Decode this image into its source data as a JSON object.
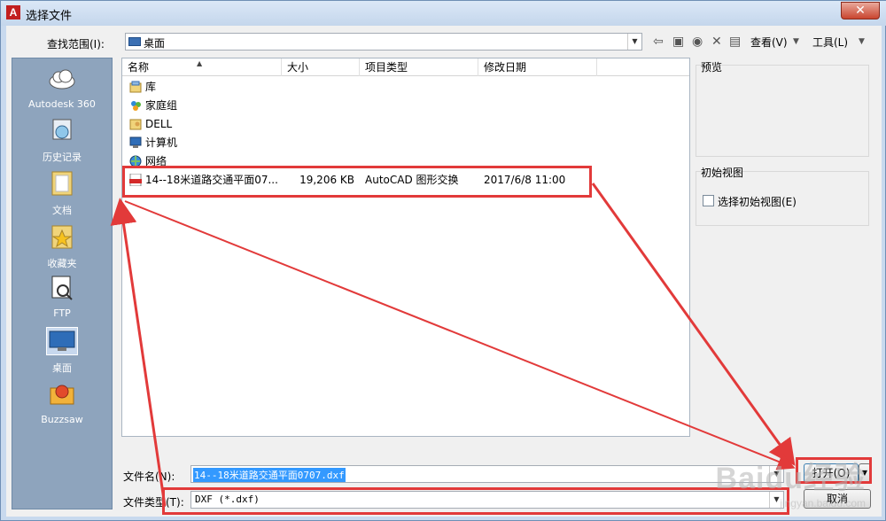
{
  "window": {
    "app_icon": "A",
    "title": "选择文件",
    "close_label": "✕"
  },
  "toolbar": {
    "lookin_label": "查找范围(I):",
    "lookin_value": "桌面",
    "view_label": "查看(V)",
    "tools_label": "工具(L)"
  },
  "places": [
    {
      "label": "Autodesk 360",
      "icon": "cloud-icon"
    },
    {
      "label": "历史记录",
      "icon": "history-icon"
    },
    {
      "label": "文档",
      "icon": "documents-icon"
    },
    {
      "label": "收藏夹",
      "icon": "favorites-icon"
    },
    {
      "label": "FTP",
      "icon": "ftp-icon"
    },
    {
      "label": "桌面",
      "icon": "desktop-icon"
    },
    {
      "label": "Buzzsaw",
      "icon": "buzzsaw-icon"
    }
  ],
  "columns": [
    "名称",
    "大小",
    "项目类型",
    "修改日期"
  ],
  "files": [
    {
      "name": "库",
      "size": "",
      "type": "",
      "date": "",
      "icon": "library-icon"
    },
    {
      "name": "家庭组",
      "size": "",
      "type": "",
      "date": "",
      "icon": "homegroup-icon"
    },
    {
      "name": "DELL",
      "size": "",
      "type": "",
      "date": "",
      "icon": "user-folder-icon"
    },
    {
      "name": "计算机",
      "size": "",
      "type": "",
      "date": "",
      "icon": "computer-icon"
    },
    {
      "name": "网络",
      "size": "",
      "type": "",
      "date": "",
      "icon": "network-icon"
    },
    {
      "name": "14--18米道路交通平面07...",
      "size": "19,206 KB",
      "type": "AutoCAD 图形交换",
      "date": "2017/6/8 11:00",
      "icon": "dxf-file-icon"
    }
  ],
  "side": {
    "preview_label": "预览",
    "initview_label": "初始视图",
    "initview_checkbox": "选择初始视图(E)"
  },
  "bottom": {
    "filename_label": "文件名(N):",
    "filename_value": "14--18米道路交通平面0707.dxf",
    "filetype_label": "文件类型(T):",
    "filetype_value": "DXF (*.dxf)",
    "open_label": "打开(O)",
    "cancel_label": "取消"
  },
  "watermark": {
    "brand": "Baidu经验",
    "url": "jingyan.baidu.com"
  },
  "colors": {
    "annotation": "#e23a3a",
    "selection": "#3399ff"
  }
}
